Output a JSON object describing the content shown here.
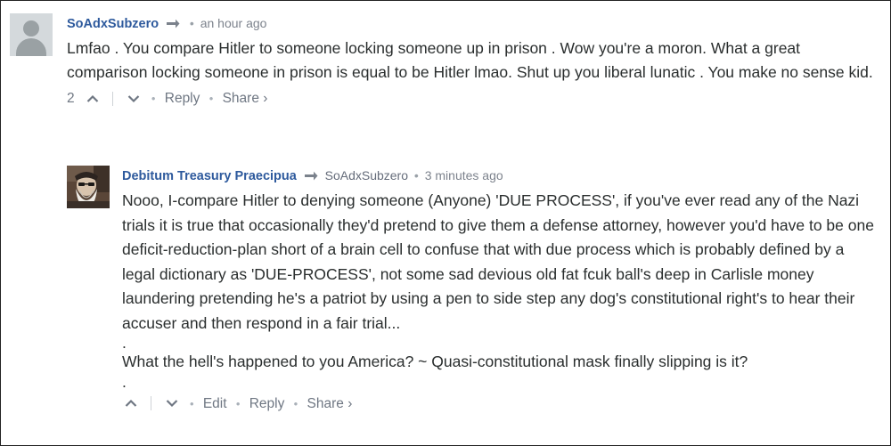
{
  "comments": [
    {
      "author": "SoAdxSubzero",
      "time": "an hour ago",
      "text": "Lmfao . You compare Hitler to someone locking someone up in prison . Wow you're a moron. What a great comparison locking someone in prison is equal to be Hitler lmao. Shut up you liberal lunatic . You make no sense kid.",
      "votes": "2",
      "reply_label": "Reply",
      "share_label": "Share ›"
    },
    {
      "author": "Debitum Treasury Praecipua",
      "parent": "SoAdxSubzero",
      "time": "3 minutes ago",
      "paragraphs": [
        "Nooo, I-compare Hitler to denying someone (Anyone) 'DUE PROCESS', if you've ever read any of the Nazi trials it is true that occasionally they'd pretend to give them a defense attorney, however you'd have to be one deficit-reduction-plan short of a brain cell to confuse that with due process which is probably defined by a legal dictionary as 'DUE-PROCESS', not some sad devious old fat fcuk ball's deep in Carlisle money laundering pretending he's a patriot by using a pen to side step any dog's constitutional right's to hear their accuser and then respond in a fair trial...",
        ".",
        "What the hell's happened to you America? ~ Quasi-constitutional mask finally slipping is it?",
        "."
      ],
      "edit_label": "Edit",
      "reply_label": "Reply",
      "share_label": "Share ›"
    }
  ],
  "separator": "•",
  "colors": {
    "author": "#2e5a9d",
    "meta": "#7d838d",
    "text": "#2a2e2e",
    "footer": "#6f7783"
  },
  "icons": {
    "reply_arrow": "reply-arrow-icon",
    "upvote": "chevron-up-icon",
    "downvote": "chevron-down-icon"
  }
}
